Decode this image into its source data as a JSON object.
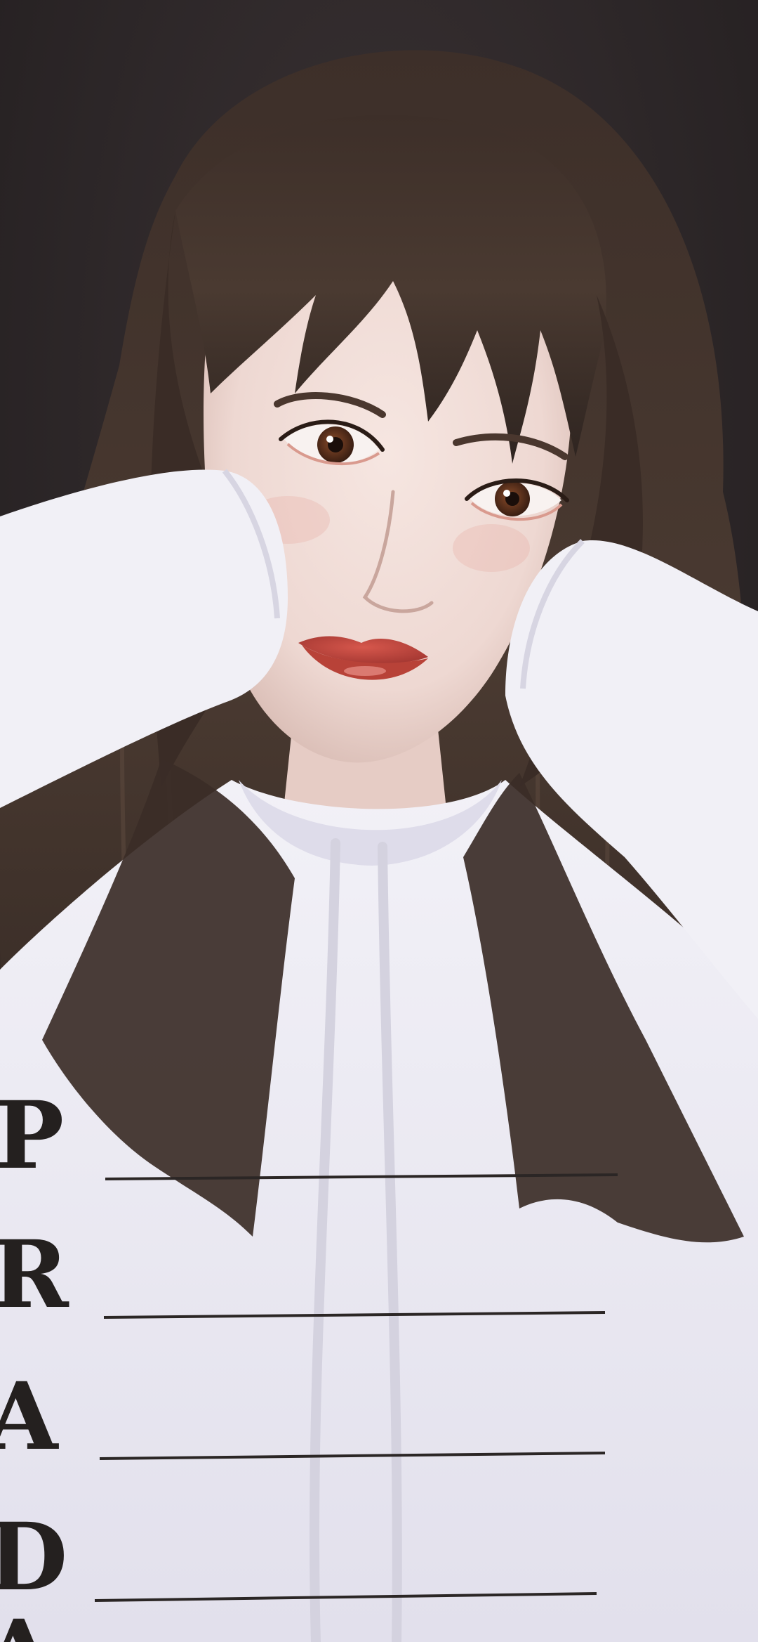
{
  "photo": {
    "subject": "portrait",
    "sweatshirt_print": {
      "letters": [
        "P",
        "R",
        "A",
        "D",
        "A"
      ]
    },
    "palette": {
      "background": "#2a2526",
      "hair": "#3a2c26",
      "hair_highlight": "#5a463c",
      "skin": "#f0dcd6",
      "skin_shadow": "#dcc0b8",
      "lips": "#c0463e",
      "iris": "#6a3a22",
      "sweatshirt": "#ecebf3",
      "sweatshirt_shadow": "#cfcddb",
      "print_ink": "#24201f"
    }
  }
}
